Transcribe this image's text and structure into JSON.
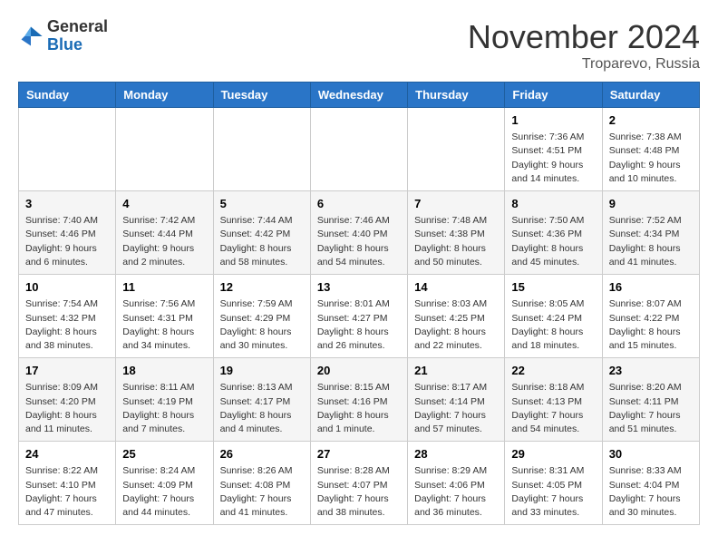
{
  "header": {
    "logo_general": "General",
    "logo_blue": "Blue",
    "month_title": "November 2024",
    "location": "Troparevo, Russia"
  },
  "weekdays": [
    "Sunday",
    "Monday",
    "Tuesday",
    "Wednesday",
    "Thursday",
    "Friday",
    "Saturday"
  ],
  "weeks": [
    [
      {
        "day": "",
        "info": ""
      },
      {
        "day": "",
        "info": ""
      },
      {
        "day": "",
        "info": ""
      },
      {
        "day": "",
        "info": ""
      },
      {
        "day": "",
        "info": ""
      },
      {
        "day": "1",
        "info": "Sunrise: 7:36 AM\nSunset: 4:51 PM\nDaylight: 9 hours and 14 minutes."
      },
      {
        "day": "2",
        "info": "Sunrise: 7:38 AM\nSunset: 4:48 PM\nDaylight: 9 hours and 10 minutes."
      }
    ],
    [
      {
        "day": "3",
        "info": "Sunrise: 7:40 AM\nSunset: 4:46 PM\nDaylight: 9 hours and 6 minutes."
      },
      {
        "day": "4",
        "info": "Sunrise: 7:42 AM\nSunset: 4:44 PM\nDaylight: 9 hours and 2 minutes."
      },
      {
        "day": "5",
        "info": "Sunrise: 7:44 AM\nSunset: 4:42 PM\nDaylight: 8 hours and 58 minutes."
      },
      {
        "day": "6",
        "info": "Sunrise: 7:46 AM\nSunset: 4:40 PM\nDaylight: 8 hours and 54 minutes."
      },
      {
        "day": "7",
        "info": "Sunrise: 7:48 AM\nSunset: 4:38 PM\nDaylight: 8 hours and 50 minutes."
      },
      {
        "day": "8",
        "info": "Sunrise: 7:50 AM\nSunset: 4:36 PM\nDaylight: 8 hours and 45 minutes."
      },
      {
        "day": "9",
        "info": "Sunrise: 7:52 AM\nSunset: 4:34 PM\nDaylight: 8 hours and 41 minutes."
      }
    ],
    [
      {
        "day": "10",
        "info": "Sunrise: 7:54 AM\nSunset: 4:32 PM\nDaylight: 8 hours and 38 minutes."
      },
      {
        "day": "11",
        "info": "Sunrise: 7:56 AM\nSunset: 4:31 PM\nDaylight: 8 hours and 34 minutes."
      },
      {
        "day": "12",
        "info": "Sunrise: 7:59 AM\nSunset: 4:29 PM\nDaylight: 8 hours and 30 minutes."
      },
      {
        "day": "13",
        "info": "Sunrise: 8:01 AM\nSunset: 4:27 PM\nDaylight: 8 hours and 26 minutes."
      },
      {
        "day": "14",
        "info": "Sunrise: 8:03 AM\nSunset: 4:25 PM\nDaylight: 8 hours and 22 minutes."
      },
      {
        "day": "15",
        "info": "Sunrise: 8:05 AM\nSunset: 4:24 PM\nDaylight: 8 hours and 18 minutes."
      },
      {
        "day": "16",
        "info": "Sunrise: 8:07 AM\nSunset: 4:22 PM\nDaylight: 8 hours and 15 minutes."
      }
    ],
    [
      {
        "day": "17",
        "info": "Sunrise: 8:09 AM\nSunset: 4:20 PM\nDaylight: 8 hours and 11 minutes."
      },
      {
        "day": "18",
        "info": "Sunrise: 8:11 AM\nSunset: 4:19 PM\nDaylight: 8 hours and 7 minutes."
      },
      {
        "day": "19",
        "info": "Sunrise: 8:13 AM\nSunset: 4:17 PM\nDaylight: 8 hours and 4 minutes."
      },
      {
        "day": "20",
        "info": "Sunrise: 8:15 AM\nSunset: 4:16 PM\nDaylight: 8 hours and 1 minute."
      },
      {
        "day": "21",
        "info": "Sunrise: 8:17 AM\nSunset: 4:14 PM\nDaylight: 7 hours and 57 minutes."
      },
      {
        "day": "22",
        "info": "Sunrise: 8:18 AM\nSunset: 4:13 PM\nDaylight: 7 hours and 54 minutes."
      },
      {
        "day": "23",
        "info": "Sunrise: 8:20 AM\nSunset: 4:11 PM\nDaylight: 7 hours and 51 minutes."
      }
    ],
    [
      {
        "day": "24",
        "info": "Sunrise: 8:22 AM\nSunset: 4:10 PM\nDaylight: 7 hours and 47 minutes."
      },
      {
        "day": "25",
        "info": "Sunrise: 8:24 AM\nSunset: 4:09 PM\nDaylight: 7 hours and 44 minutes."
      },
      {
        "day": "26",
        "info": "Sunrise: 8:26 AM\nSunset: 4:08 PM\nDaylight: 7 hours and 41 minutes."
      },
      {
        "day": "27",
        "info": "Sunrise: 8:28 AM\nSunset: 4:07 PM\nDaylight: 7 hours and 38 minutes."
      },
      {
        "day": "28",
        "info": "Sunrise: 8:29 AM\nSunset: 4:06 PM\nDaylight: 7 hours and 36 minutes."
      },
      {
        "day": "29",
        "info": "Sunrise: 8:31 AM\nSunset: 4:05 PM\nDaylight: 7 hours and 33 minutes."
      },
      {
        "day": "30",
        "info": "Sunrise: 8:33 AM\nSunset: 4:04 PM\nDaylight: 7 hours and 30 minutes."
      }
    ]
  ]
}
